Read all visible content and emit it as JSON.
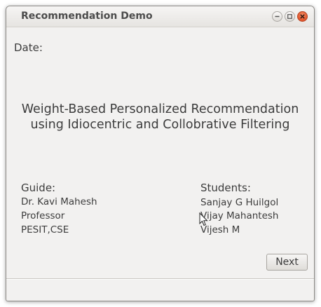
{
  "window": {
    "title": "Recommendation Demo",
    "controls": [
      "minimize-icon",
      "maximize-icon",
      "close-icon"
    ]
  },
  "main": {
    "date_label": "Date:",
    "headline_line1": "Weight-Based Personalized Recommendation",
    "headline_line2": "using Idiocentric and Collobrative Filtering",
    "guide": {
      "heading": "Guide:",
      "lines": [
        "Dr. Kavi Mahesh",
        "Professor",
        "PESIT,CSE"
      ]
    },
    "students": {
      "heading": "Students:",
      "lines": [
        "Sanjay G Huilgol",
        "Vijay Mahantesh",
        "Vijesh M"
      ]
    },
    "next_label": "Next"
  },
  "colors": {
    "close_button": "#e2542a",
    "window_bg": "#f2f1f0",
    "text": "#3c3c3c"
  }
}
